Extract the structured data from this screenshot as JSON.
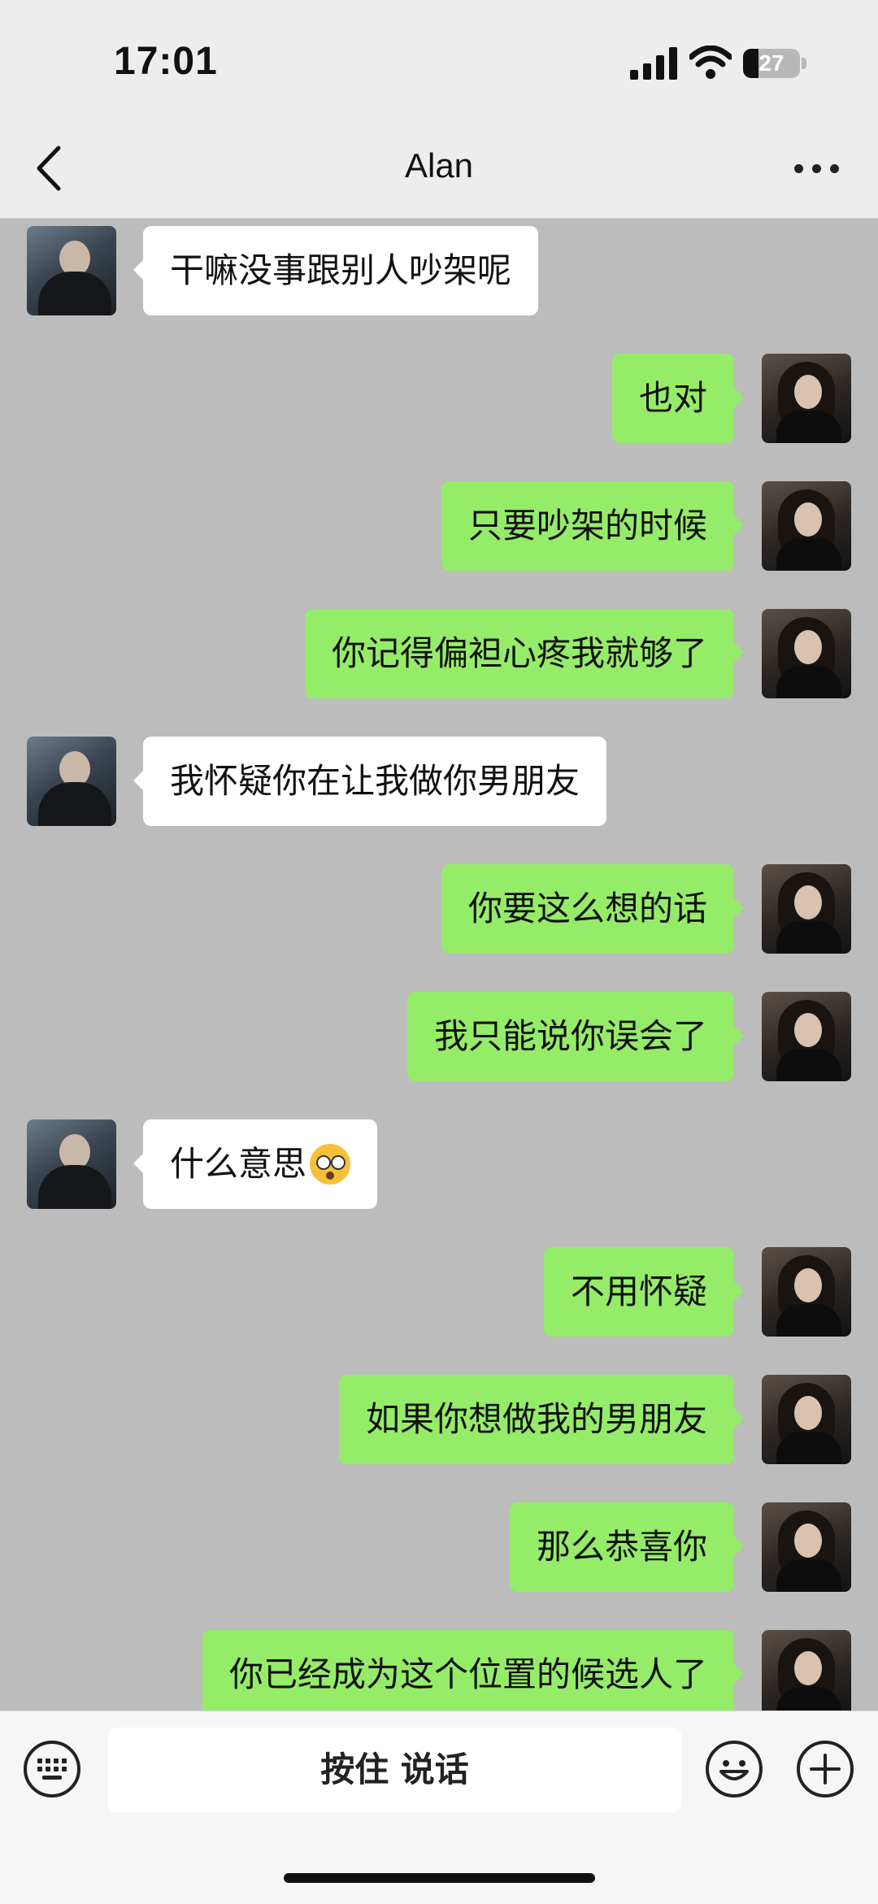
{
  "status_bar": {
    "time": "17:01",
    "battery": "27",
    "battery_level": 0.27
  },
  "header": {
    "title": "Alan"
  },
  "messages": [
    {
      "side": "peer",
      "text": "干嘛没事跟别人吵架呢"
    },
    {
      "side": "self",
      "text": "也对"
    },
    {
      "side": "self",
      "text": "只要吵架的时候"
    },
    {
      "side": "self",
      "text": "你记得偏袒心疼我就够了"
    },
    {
      "side": "peer",
      "text": "我怀疑你在让我做你男朋友"
    },
    {
      "side": "self",
      "text": "你要这么想的话"
    },
    {
      "side": "self",
      "text": "我只能说你误会了"
    },
    {
      "side": "peer",
      "text": "什么意思",
      "emoji": "flushed-face-icon"
    },
    {
      "side": "self",
      "text": "不用怀疑"
    },
    {
      "side": "self",
      "text": "如果你想做我的男朋友"
    },
    {
      "side": "self",
      "text": "那么恭喜你"
    },
    {
      "side": "self",
      "text": "你已经成为这个位置的候选人了"
    }
  ],
  "input_bar": {
    "hold_to_talk": "按住 说话"
  },
  "colors": {
    "self_bubble": "#95ec69",
    "peer_bubble": "#ffffff",
    "chat_background": "#bcbcbc"
  }
}
